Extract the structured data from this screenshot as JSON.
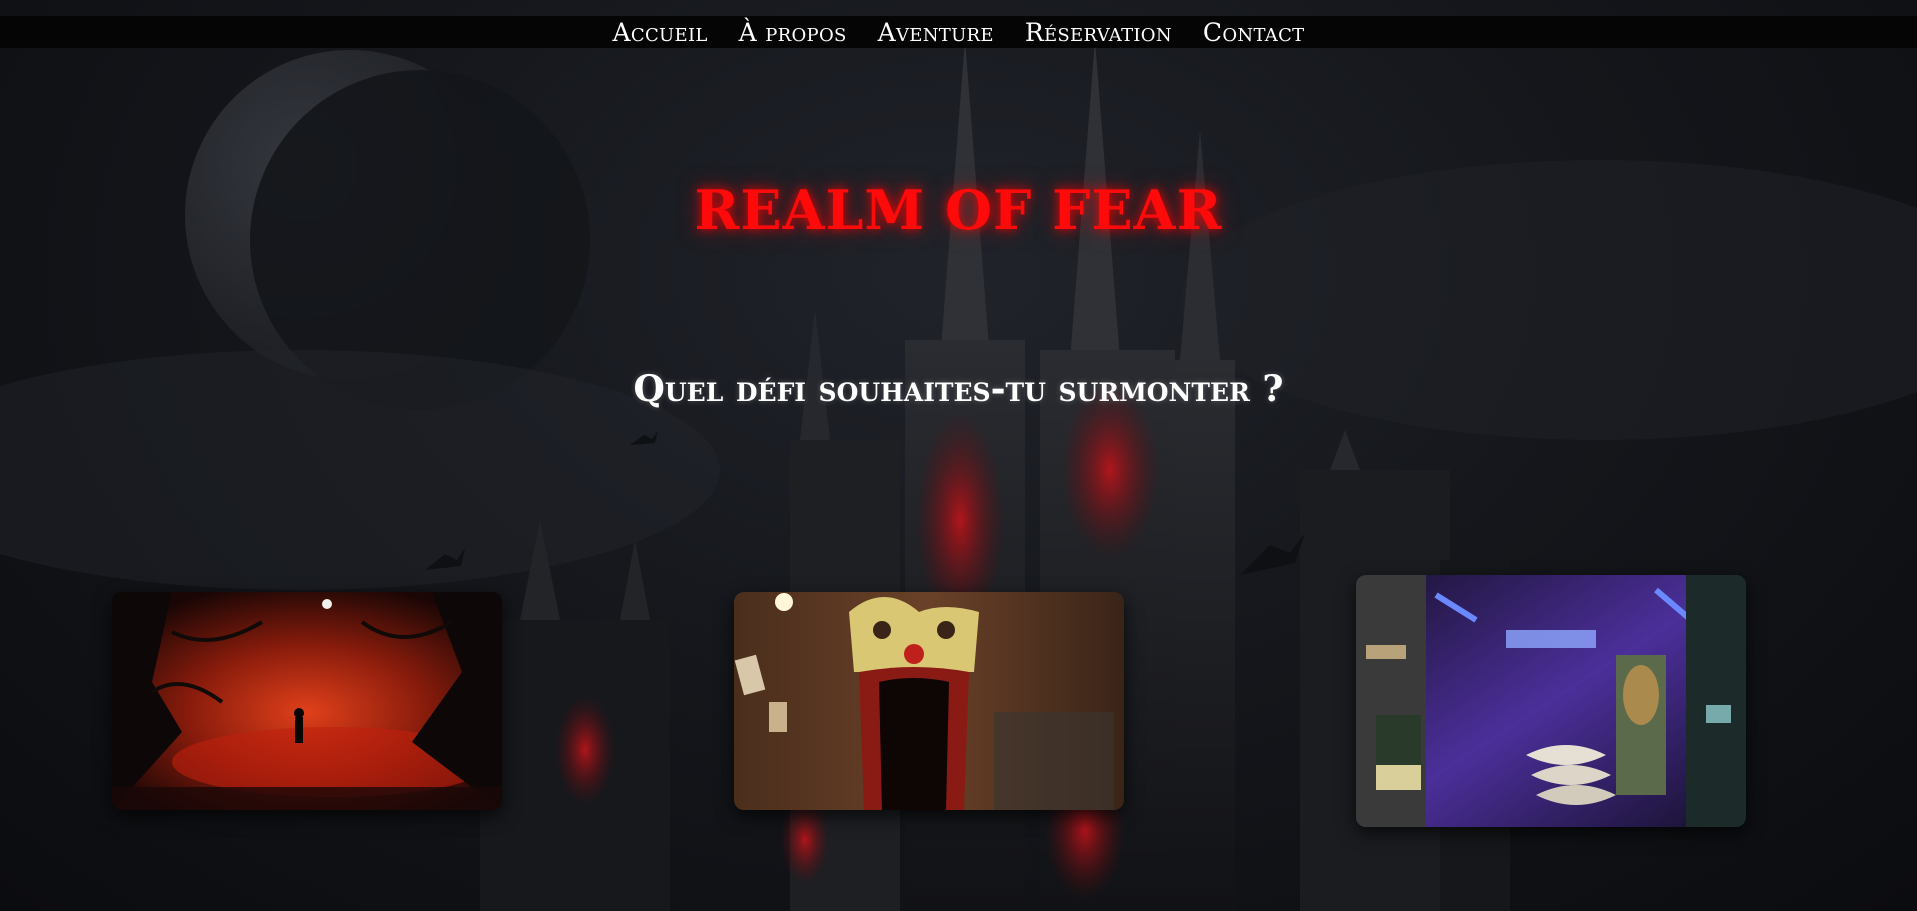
{
  "nav": {
    "items": [
      {
        "label": "Accueil"
      },
      {
        "label": "À propos"
      },
      {
        "label": "Aventure"
      },
      {
        "label": "Réservation"
      },
      {
        "label": "Contact"
      }
    ]
  },
  "hero": {
    "title": "REALM OF FEAR"
  },
  "section": {
    "heading": "Quel défi souhaites-tu surmonter ?"
  },
  "cards": [
    {
      "image": "dark-forest-image"
    },
    {
      "image": "clown-mouth-corridor-image"
    },
    {
      "image": "neon-bunker-room-image"
    }
  ],
  "colors": {
    "title_red": "#ff0a0a",
    "nav_bg": "#050506",
    "text_white": "#ffffff"
  }
}
